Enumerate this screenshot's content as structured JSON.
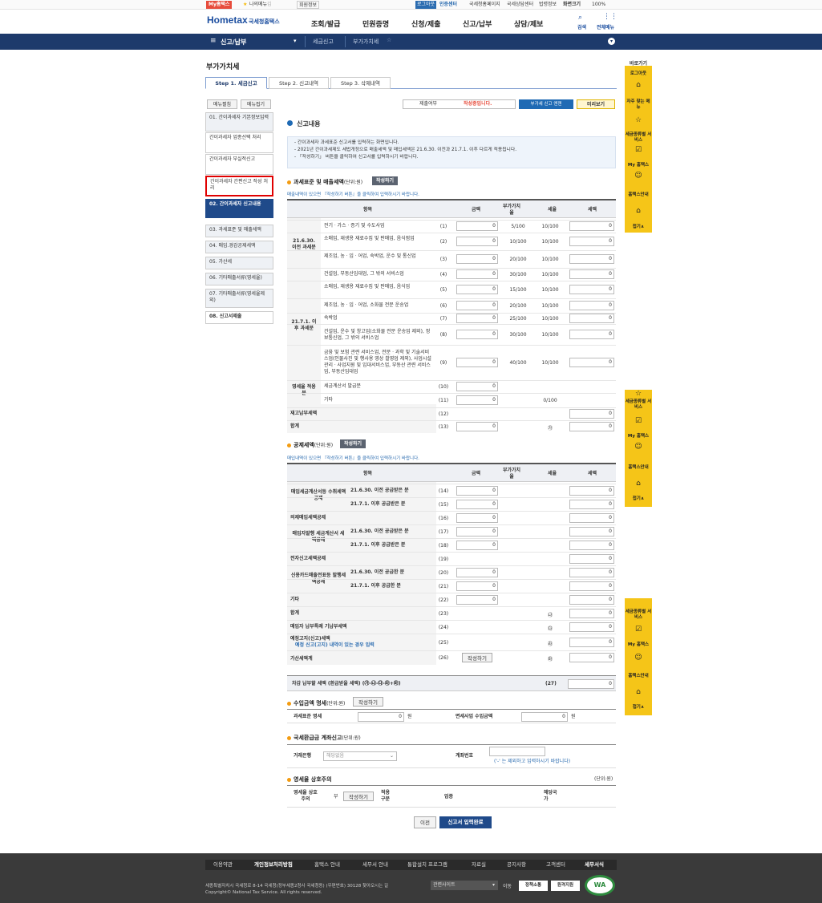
{
  "topbar": {
    "my_hometax": "My홈택스",
    "favorites": "나의메뉴",
    "user_name": "김",
    "member_info": "회원정보",
    "logout": "로그아웃",
    "auth_center": "인증센터",
    "nts_homepage": "국세청홈페이지",
    "nts_consult": "국세상담센터",
    "info": "법령정보",
    "zoom_label": "화면크기",
    "zoom_value": "100%"
  },
  "header": {
    "logo_en": "Hometax",
    "logo_ko": "국세청홈택스",
    "search": "검색",
    "all_menu": "전체메뉴",
    "gnb": [
      "조회/발급",
      "민원증명",
      "신청/제출",
      "신고/납부",
      "상담/제보"
    ]
  },
  "subnav": {
    "menu": "신고/납부",
    "crumb1": "세금신고",
    "crumb2": "부가가치세"
  },
  "page": {
    "title": "부가가치세",
    "tabs": [
      "Step 1. 세금신고",
      "Step 2. 신고내역",
      "Step 3. 삭제내역"
    ],
    "expand": "메뉴펼침",
    "collapse": "메뉴접기",
    "sidebar": [
      {
        "label": "01. 간이과세자 기본정보입력",
        "state": "normal"
      },
      {
        "label": "간이과세자 업종선택 처리",
        "state": "sub"
      },
      {
        "label": "간이과세자 부실적신고",
        "state": "sub"
      },
      {
        "label": "간이과세자 간편신고 작성 처리",
        "state": "highlight"
      },
      {
        "label": "02. 간이과세자 신고내용",
        "state": "active"
      },
      {
        "label": "03. 과세표준 및 매출세액",
        "state": "normal"
      },
      {
        "label": "04. 매입.경감공제세액",
        "state": "normal"
      },
      {
        "label": "05. 가산세",
        "state": "normal"
      },
      {
        "label": "06. 기타매출서류(영세율)",
        "state": "normal"
      },
      {
        "label": "07. 기타매출서류(영세율제외)",
        "state": "normal"
      },
      {
        "label": "08. 신고서제출",
        "state": "normal"
      }
    ],
    "status_label": "제출여부",
    "status_value": "작성중입니다.",
    "guide_btn": "부가세 신고 엔젠",
    "preview_btn": "미리보기"
  },
  "section_title": "신고내용",
  "notice": [
    "- 간이과세자 과세표준 신고서를 입력하는 화면입니다.",
    "- 2021년 간이과세제도 세법개정으로 매출세액 및 매입세액은 21.6.30. 이전과 21.7.1. 이후 다르게 적용됩니다.",
    "- 「작성하기」 버튼을 클릭하여 신고서를 입력하시기 바랍니다."
  ],
  "sales": {
    "title": "과세표준 및 매출세액",
    "unit": "(단위:원)",
    "write_btn": "작성하기",
    "hint": "매출내역이 있으면 『작성하기 버튼』을 클릭하여 입력하시기 바랍니다.",
    "col_item": "항목",
    "col_amount": "금액",
    "col_rate": "부가가치율",
    "col_taxrate": "세율",
    "col_tax": "세액",
    "group1": "21.6.30. 이전 과세분",
    "group2": "21.7.1. 이후 과세분",
    "group3": "영세율 적용분",
    "rows": [
      {
        "label": "전기ㆍ가스ㆍ증기 및 수도사업",
        "no": "(1)",
        "amount": "0",
        "rate": "5/100",
        "taxrate": "10/100",
        "tax": "0"
      },
      {
        "label": "소매업, 재생용 재료수집 및 판매업, 음식점업",
        "no": "(2)",
        "amount": "0",
        "rate": "10/100",
        "taxrate": "10/100",
        "tax": "0"
      },
      {
        "label": "제조업, 농ㆍ임ㆍ어업, 숙박업, 운수 및 통신업",
        "no": "(3)",
        "amount": "0",
        "rate": "20/100",
        "taxrate": "10/100",
        "tax": "0"
      },
      {
        "label": "건설업, 부동산임대업, 그 밖의 서비스업",
        "no": "(4)",
        "amount": "0",
        "rate": "30/100",
        "taxrate": "10/100",
        "tax": "0"
      },
      {
        "label": "소매업, 재생용 재료수집 및 판매업, 음식업",
        "no": "(5)",
        "amount": "0",
        "rate": "15/100",
        "taxrate": "10/100",
        "tax": "0"
      },
      {
        "label": "제조업, 농ㆍ임ㆍ어업, 소화물 전문 운송업",
        "no": "(6)",
        "amount": "0",
        "rate": "20/100",
        "taxrate": "10/100",
        "tax": "0"
      },
      {
        "label": "숙박업",
        "no": "(7)",
        "amount": "0",
        "rate": "25/100",
        "taxrate": "10/100",
        "tax": "0"
      },
      {
        "label": "건설업, 운수 및 창고업(소화물 전문 운송업 제외), 정보통신업, 그 밖의 서비스업",
        "no": "(8)",
        "amount": "0",
        "rate": "30/100",
        "taxrate": "10/100",
        "tax": "0"
      },
      {
        "label": "금융 및 보험 관련 서비스업, 전문ㆍ과학 및 기술서비스업(인물사진 및 행사용 영상 촬영업 제외), 사업시설관리ㆍ사업지원 및 임대서비스업, 부동산 관련 서비스업, 부동산임대업",
        "no": "(9)",
        "amount": "0",
        "rate": "40/100",
        "taxrate": "10/100",
        "tax": "0"
      },
      {
        "label": "세금계산서 발급분",
        "no": "(10)",
        "amount": "0",
        "rate": "",
        "taxrate": "",
        "tax": ""
      },
      {
        "label": "기타",
        "no": "(11)",
        "amount": "0",
        "rate": "",
        "taxrate": "0/100",
        "tax": ""
      },
      {
        "label": "재고납부세액",
        "no": "(12)",
        "amount": "",
        "rate": "",
        "taxrate": "",
        "tax": "0"
      },
      {
        "label": "합계",
        "no": "(13)",
        "amount": "0",
        "rate": "",
        "taxrate": "㉮",
        "tax": "0"
      }
    ]
  },
  "deduct": {
    "title": "공제세액",
    "unit": "(단위:원)",
    "write_btn": "작성하기",
    "hint": "매입내역이 있으면 『작성하기 버튼』을 클릭하여 입력하시기 바랍니다.",
    "col_item": "항목",
    "col_amount": "금액",
    "col_rate": "부가가치율",
    "col_taxrate": "세율",
    "col_tax": "세액",
    "g1": "매입세금계산서등 수취세액공제",
    "g2": "의제매입세액공제",
    "g3": "매입자발행 세금계산서 세액공제",
    "g4": "전자신고세액공제",
    "g5": "신용카드매출전표등 발행세액공제",
    "g6": "기타",
    "g7": "합계",
    "g8": "매입자 납부특례 기납부세액",
    "g9": "예정고지(신고)세액",
    "g9sub": "예정 신고(고지) 내역이 있는 경우 입력",
    "g10": "가산세액계",
    "rows": [
      {
        "sub": "21.6.30. 이전 공급받은 분",
        "no": "(14)",
        "amount": "0",
        "mark": "",
        "tax": "0"
      },
      {
        "sub": "21.7.1. 이후 공급받은 분",
        "no": "(15)",
        "amount": "0",
        "mark": "",
        "tax": "0"
      },
      {
        "sub": "",
        "no": "(16)",
        "amount": "0",
        "mark": "",
        "tax": "0"
      },
      {
        "sub": "21.6.30. 이전 공급받은 분",
        "no": "(17)",
        "amount": "0",
        "mark": "",
        "tax": "0"
      },
      {
        "sub": "21.7.1. 이후 공급받은 분",
        "no": "(18)",
        "amount": "0",
        "mark": "",
        "tax": "0"
      },
      {
        "sub": "",
        "no": "(19)",
        "amount": "",
        "mark": "",
        "tax": "0"
      },
      {
        "sub": "21.6.30. 이전 공급한 분",
        "no": "(20)",
        "amount": "0",
        "mark": "",
        "tax": "0"
      },
      {
        "sub": "21.7.1. 이후 공급한 분",
        "no": "(21)",
        "amount": "0",
        "mark": "",
        "tax": "0"
      },
      {
        "sub": "",
        "no": "(22)",
        "amount": "0",
        "mark": "",
        "tax": "0"
      },
      {
        "sub": "",
        "no": "(23)",
        "amount": "",
        "mark": "㉯",
        "tax": "0"
      },
      {
        "sub": "",
        "no": "(24)",
        "amount": "",
        "mark": "㉰",
        "tax": "0"
      },
      {
        "sub": "",
        "no": "(25)",
        "amount": "",
        "mark": "㉱",
        "tax": "0"
      },
      {
        "sub": "",
        "no": "(26)",
        "amount": "작성하기",
        "mark": "㉲",
        "tax": "0"
      }
    ],
    "final_label": "차감 납부할 세액 (환급받을 세액) (㉮-㉯-㉰-㉱+㉲)",
    "final_no": "(27)",
    "final_value": "0"
  },
  "income": {
    "title": "수입금액 명세",
    "unit": "(단위:원)",
    "write_btn": "작성하기",
    "tax_label": "과세표준 명세",
    "tax_value": "0",
    "won1": "원",
    "exempt_label": "면세사업 수입금액",
    "exempt_value": "0",
    "won2": "원"
  },
  "refund": {
    "title": "국세환급금 계좌신고",
    "unit": "(단위:원)",
    "bank_label": "거래은행",
    "bank_placeholder": "해당없음",
    "account_label": "계좌번호",
    "account_hint": "('-' 는 제외하고 입력하시기 바랍니다)"
  },
  "zero": {
    "title": "영세율 상호주의",
    "unit": "(단위:원)",
    "label": "영세율 상호주의",
    "value": "부",
    "write_btn": "작성하기",
    "apply": "적용구분",
    "biz": "업종",
    "country": "해당국가"
  },
  "actions": {
    "prev": "이전",
    "complete": "신고서 입력완료"
  },
  "quick": {
    "title": "바로가기",
    "items": [
      "로그아웃",
      "자주 찾는 메뉴",
      "세금종류별 서비스",
      "My 홈택스",
      "홈택스안내",
      "접기∧"
    ],
    "items2": [
      "세금종류별 서비스",
      "My 홈택스",
      "홈택스안내",
      "접기∧"
    ]
  },
  "footer": {
    "links": [
      "이용약관",
      "개인정보처리방침",
      "홈택스 안내",
      "세무서 안내",
      "통합설치 프로그램",
      "자료실",
      "공지사항",
      "고객센터",
      "세무서식"
    ],
    "address": "세종특별자치시 국세청로 8-14 국세청(정부세종2청사 국세청동) (우편번호) 30128  찾아오시는 길",
    "copyright": "Copyright© National Tax Service. All rights reserved.",
    "related": "관련사이트",
    "go": "이동",
    "badge1": "정책소통",
    "badge2": "원격지원",
    "wa": "WA"
  },
  "colors": {
    "navy": "#1d3a6b",
    "active": "#1f4a8a",
    "accent": "#f39c12",
    "quick": "#f5c518",
    "highlight": "#e00000",
    "footer": "#3a3a3a"
  }
}
